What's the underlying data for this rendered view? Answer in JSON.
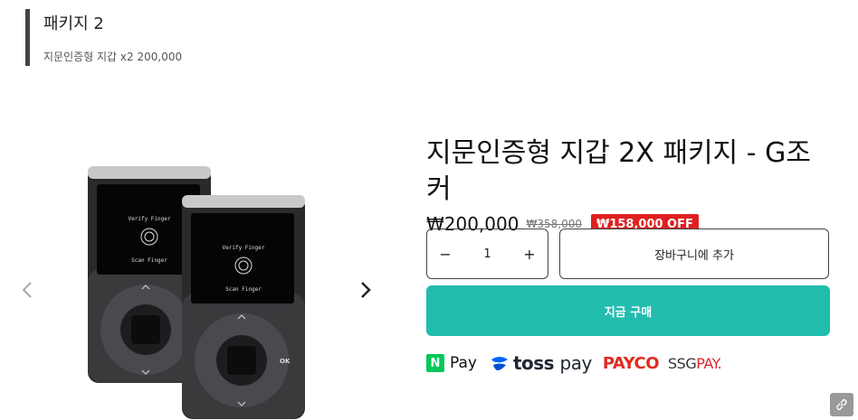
{
  "package": {
    "title": "패키지 2",
    "subtitle": "지문인증형 지갑 x2 200,000"
  },
  "product": {
    "title": "지문인증형 지갑 2X 패키지 - G조커",
    "price": "₩200,000",
    "original_price": "₩358,000",
    "discount_badge": "₩158,000 OFF",
    "device_screen_verify": "Verify Finger",
    "device_screen_scan": "Scan Finger",
    "device_ok": "OK"
  },
  "quantity": {
    "minus": "−",
    "value": "1",
    "plus": "+"
  },
  "actions": {
    "add_to_cart": "장바구니에 추가",
    "buy_now": "지금 구매"
  },
  "payments": {
    "npay_n": "N",
    "npay_label": "Pay",
    "toss_label": "toss",
    "toss_pay": "pay",
    "payco_label": "PAYCO",
    "ssg_label": "SSG",
    "ssg_pay": "PAY."
  },
  "gallery": {
    "prev_icon": "chevron-left-icon",
    "next_icon": "chevron-right-icon"
  },
  "colors": {
    "buy_button": "#22bcaf",
    "discount_badge": "#e02020",
    "npay_green": "#03c75a",
    "payco_red": "#e02b22",
    "toss_blue": "#0064ff"
  }
}
